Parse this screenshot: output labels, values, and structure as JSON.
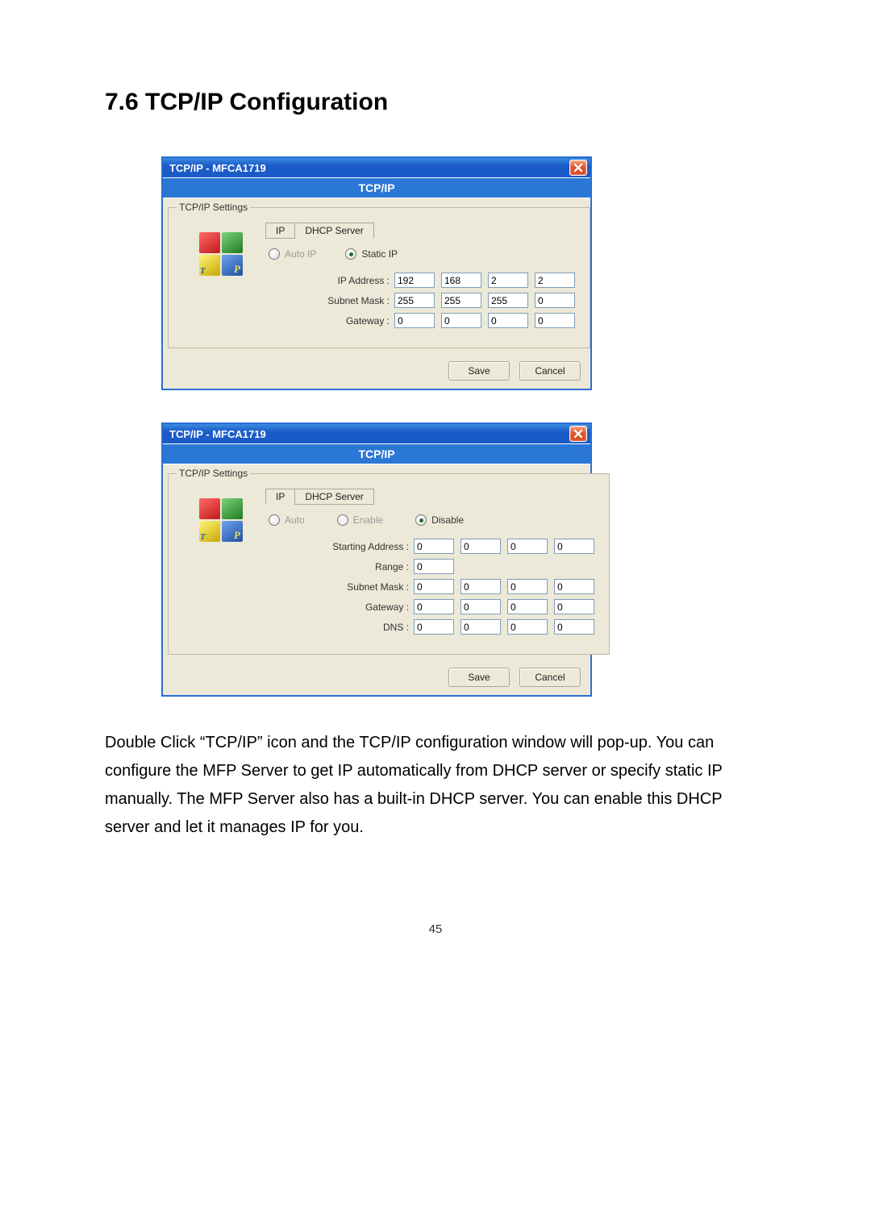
{
  "heading": "7.6   TCP/IP Configuration",
  "dialog1": {
    "title": "TCP/IP - MFCA1719",
    "panel_title": "TCP/IP",
    "group_legend": "TCP/IP Settings",
    "tabs": {
      "ip": "IP",
      "dhcp": "DHCP Server"
    },
    "radios": {
      "auto_ip": "Auto IP",
      "static_ip": "Static IP"
    },
    "labels": {
      "ip_address": "IP Address :",
      "subnet_mask": "Subnet Mask :",
      "gateway": "Gateway :"
    },
    "ip_address": [
      "192",
      "168",
      "2",
      "2"
    ],
    "subnet_mask": [
      "255",
      "255",
      "255",
      "0"
    ],
    "gateway": [
      "0",
      "0",
      "0",
      "0"
    ],
    "buttons": {
      "save": "Save",
      "cancel": "Cancel"
    }
  },
  "dialog2": {
    "title": "TCP/IP - MFCA1719",
    "panel_title": "TCP/IP",
    "group_legend": "TCP/IP Settings",
    "tabs": {
      "ip": "IP",
      "dhcp": "DHCP Server"
    },
    "radios": {
      "auto": "Auto",
      "enable": "Enable",
      "disable": "Disable"
    },
    "labels": {
      "starting_address": "Starting Address :",
      "range": "Range :",
      "subnet_mask": "Subnet Mask :",
      "gateway": "Gateway :",
      "dns": "DNS :"
    },
    "starting_address": [
      "0",
      "0",
      "0",
      "0"
    ],
    "range": "0",
    "subnet_mask": [
      "0",
      "0",
      "0",
      "0"
    ],
    "gateway": [
      "0",
      "0",
      "0",
      "0"
    ],
    "dns": [
      "0",
      "0",
      "0",
      "0"
    ],
    "buttons": {
      "save": "Save",
      "cancel": "Cancel"
    }
  },
  "paragraph": "Double Click “TCP/IP” icon and the TCP/IP configuration window will pop-up. You can configure the MFP Server to get IP automatically from DHCP server or specify static IP manually. The MFP Server also has a built-in DHCP server. You can enable this DHCP server and let it manages IP for you.",
  "page_number": "45"
}
